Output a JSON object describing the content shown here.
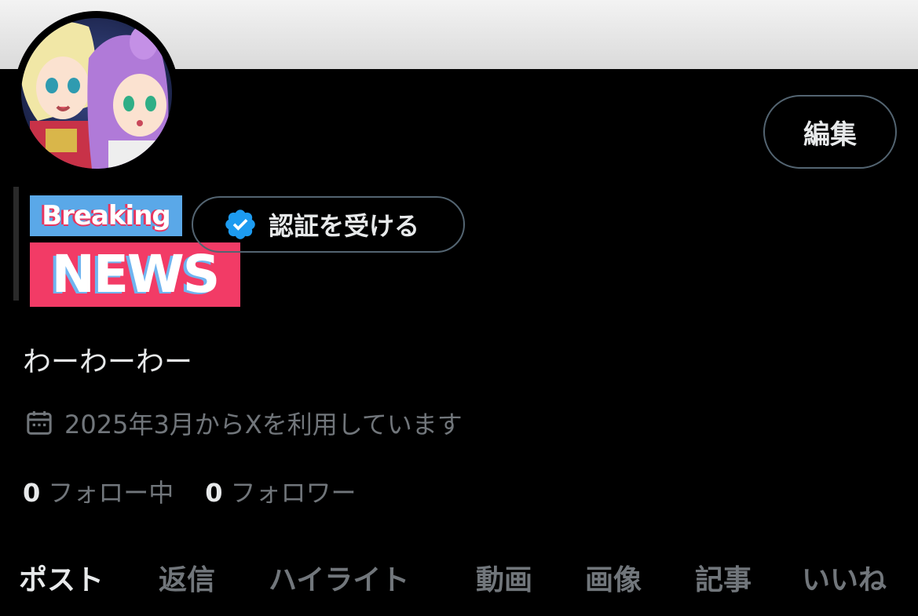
{
  "profile": {
    "edit_label": "編集",
    "banner_overlay": {
      "line1": "Breaking",
      "line2": "NEWS"
    },
    "verify_label": "認証を受ける",
    "bio": "わーわーわー",
    "joined": "2025年3月からXを利用しています",
    "following": {
      "count": "0",
      "label": "フォロー中"
    },
    "followers": {
      "count": "0",
      "label": "フォロワー"
    }
  },
  "tabs": [
    {
      "label": "ポスト",
      "active": true
    },
    {
      "label": "返信",
      "active": false
    },
    {
      "label": "ハイライト",
      "active": false
    },
    {
      "label": "動画",
      "active": false
    },
    {
      "label": "画像",
      "active": false
    },
    {
      "label": "記事",
      "active": false
    },
    {
      "label": "いいね",
      "active": false
    }
  ],
  "colors": {
    "background": "#000000",
    "text_primary": "#e7e9ea",
    "text_secondary": "#71767b",
    "border": "#536471",
    "verified_blue": "#1d9bf0",
    "news_red": "#f23b66",
    "breaking_blue": "#5aa8e8"
  },
  "icons": {
    "verified": "verified-badge-icon",
    "calendar": "calendar-icon"
  }
}
